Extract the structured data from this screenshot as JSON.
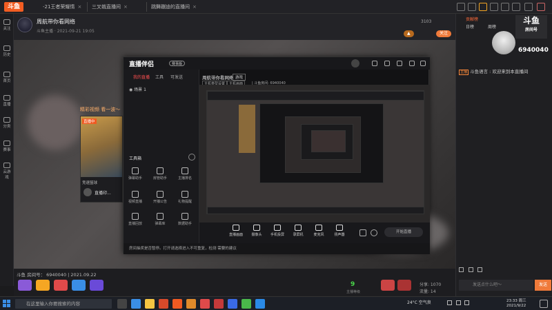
{
  "browser": {
    "logo": "斗鱼",
    "tabs": [
      "-21王者荣耀情",
      "三叉戟直播间",
      "跳舞蹦迪的直播间"
    ]
  },
  "left_nav": [
    "关注",
    "历史",
    "首页",
    "直播",
    "分类",
    "赛事",
    "云游戏"
  ],
  "room": {
    "name": "周航带你看网络",
    "meta": "斗鱼主播 · 2021-09-21 19:05",
    "followers": "3103",
    "follow_btn": "关注",
    "room_id_label": "斗鱼 房间号： 6940040 | 2021.09.22",
    "online": "9",
    "online_label": "主播等级",
    "bottom_right": [
      "分享: 1070",
      "流量: 14"
    ]
  },
  "video_labels": {
    "promo": "精彩视频 看一波～",
    "live_tag": "直播中",
    "card_caption": "竞速篮球",
    "card_name": "直播印..."
  },
  "overlay": {
    "app_title": "直播伴侣",
    "badge": "赛事版",
    "tabs": [
      "我的直播",
      "工具",
      "可发送"
    ],
    "scene_label": "场景 1",
    "room_title": "周航带你看网络",
    "room_tag": "游戏",
    "sub_info": [
      "主机类型设置",
      "主机画面",
      "| 斗鱼房间: 6940040"
    ],
    "tools_header": "工具箱",
    "tools": [
      "弹幕助手",
      "房管助手",
      "主播排名",
      "视频直播",
      "开播公告",
      "礼物提醒",
      "直播回放",
      "弹幕库",
      "数据助手"
    ],
    "controls": [
      "直播画面",
      "摄像头",
      "手机投屏",
      "录屏机",
      "麦克风",
      "扬声器"
    ],
    "start_btn": "开始直播",
    "status": "房间抽奖是否暂停。打开请选择进入不可重复，检测 需要的建议"
  },
  "right_panel": {
    "tabs": [
      "贡献榜",
      "日榜",
      "周榜"
    ],
    "room_label": "房间号",
    "room_id": "6940040",
    "brand": "斗鱼",
    "chat": [
      {
        "user": "主播",
        "text": "斗鱼语言 : 欢迎来到本直播间"
      }
    ],
    "input_placeholder": "发送点什么吧～",
    "send_btn": "发送"
  },
  "taskbar": {
    "search_placeholder": "在这里输入你要搜索的内容",
    "weather": "24°C 空气良",
    "time": "23:33 周三",
    "date": "2021/9/22"
  }
}
